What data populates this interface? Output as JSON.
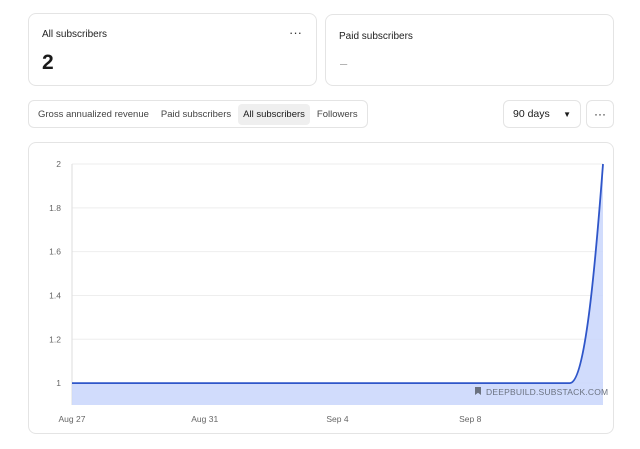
{
  "cards": {
    "all_subscribers": {
      "title": "All subscribers",
      "value": "2",
      "more": "···"
    },
    "paid_subscribers": {
      "title": "Paid subscribers",
      "value": "–"
    }
  },
  "tabs": [
    {
      "label": "Gross annualized revenue",
      "active": false
    },
    {
      "label": "Paid subscribers",
      "active": false
    },
    {
      "label": "All subscribers",
      "active": true
    },
    {
      "label": "Followers",
      "active": false
    }
  ],
  "range_select": {
    "value": "90 days",
    "caret": "▼"
  },
  "chart_more": "···",
  "colors": {
    "line": "#2f56c9",
    "fill": "#c9d6fb",
    "grid": "#eeeeee"
  },
  "chart_data": {
    "type": "area",
    "x": [
      "Aug 27",
      "Aug 28",
      "Aug 29",
      "Aug 30",
      "Aug 31",
      "Sep 1",
      "Sep 2",
      "Sep 3",
      "Sep 4",
      "Sep 5",
      "Sep 6",
      "Sep 7",
      "Sep 8",
      "Sep 9",
      "Sep 10",
      "Sep 11",
      "Sep 12"
    ],
    "values": [
      1,
      1,
      1,
      1,
      1,
      1,
      1,
      1,
      1,
      1,
      1,
      1,
      1,
      1,
      1,
      1,
      2
    ],
    "x_tick_labels": [
      "Aug 27",
      "Aug 31",
      "Sep 4",
      "Sep 8"
    ],
    "y_ticks": [
      1,
      1.2,
      1.4,
      1.6,
      1.8,
      2
    ],
    "y_tick_labels": [
      "1",
      "1.2",
      "1.4",
      "1.6",
      "1.8",
      "2"
    ],
    "ylim": [
      0.9,
      2
    ],
    "grid": true,
    "watermark": "DEEPBUILD.SUBSTACK.COM"
  }
}
